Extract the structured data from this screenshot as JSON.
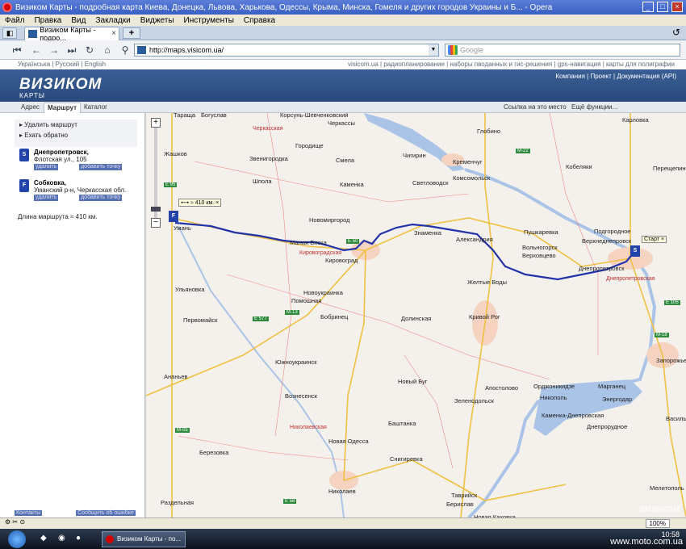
{
  "window": {
    "title": "Визиком Карты - подробная карта Киева, Донецка, Львова, Харькова, Одессы, Крыма, Минска, Гомеля и других городов Украины и Б... - Opera"
  },
  "menu": [
    "Файл",
    "Правка",
    "Вид",
    "Закладки",
    "Виджеты",
    "Инструменты",
    "Справка"
  ],
  "tab": {
    "label": "Визиком Карты - подро..."
  },
  "address": {
    "url": "http://maps.visicom.ua/",
    "search_placeholder": "Google"
  },
  "site": {
    "languages": "Українська  |  Русский  |  English",
    "top_right_links": "visicom.ua  |  радиопланирование  |  наборы пводанных и гис-решения  |  gps-навигация  |  карты для полиграфии",
    "logo": "ВИЗИКОМ",
    "logo_sub": "КАРТЫ",
    "header_links": "Компания  |  Проект  |  Документация (API)"
  },
  "panel_tabs": [
    "Адрес",
    "Маршрут",
    "Каталог"
  ],
  "map_links": {
    "link": "Ссылка на это место",
    "functions": "Ещё функции..."
  },
  "sidebar": {
    "actions": [
      "Удалить маршрут",
      "Ехать обратно"
    ],
    "start": {
      "marker": "S",
      "city": "Днепропетровск,",
      "address": "Флотская ул., 105",
      "btn1": "удалить",
      "btn2": "добавить точку"
    },
    "finish": {
      "marker": "F",
      "city": "Собковка,",
      "address": "Уманский р-н, Черкасская обл.",
      "btn1": "удалить",
      "btn2": "добавить точку"
    },
    "route_length": "Длина маршрута ≈ 410 км.",
    "bottom": {
      "contacts": "Контакты",
      "report": "Сообщить об ошибке"
    }
  },
  "map": {
    "bubble_length": "≈ 410 км.",
    "bubble_start": "Старт",
    "watermark": "ВИЗИКОМ",
    "cities": [
      {
        "n": "Черкассы"
      },
      {
        "n": "Глобино"
      },
      {
        "n": "Карловка"
      },
      {
        "n": "Городище"
      },
      {
        "n": "Звенигородка"
      },
      {
        "n": "Смела"
      },
      {
        "n": "Кременчуг"
      },
      {
        "n": "Кобеляки"
      },
      {
        "n": "Жашков"
      },
      {
        "n": "Шпола"
      },
      {
        "n": "Каменка"
      },
      {
        "n": "Светловодск"
      },
      {
        "n": "Новомиргород"
      },
      {
        "n": "Знаменка"
      },
      {
        "n": "Александрия"
      },
      {
        "n": "Пушкаревка"
      },
      {
        "n": "Подгородное"
      },
      {
        "n": "Верхнеднепровск"
      },
      {
        "n": "Вольногорск"
      },
      {
        "n": "Верховцево"
      },
      {
        "n": "Умань"
      },
      {
        "n": "Малая Виска"
      },
      {
        "n": "Кировоград"
      },
      {
        "n": "Днепропетровск"
      },
      {
        "n": "Желтые Воды"
      },
      {
        "n": "Ульяновка"
      },
      {
        "n": "Новоукраинка"
      },
      {
        "n": "Помошная"
      },
      {
        "n": "Первомайск"
      },
      {
        "n": "Бобринец"
      },
      {
        "n": "Долинская"
      },
      {
        "n": "Кривой Рог"
      },
      {
        "n": "Южноукраинск"
      },
      {
        "n": "Новый Буг"
      },
      {
        "n": "Апостолово"
      },
      {
        "n": "Зеленодольск"
      },
      {
        "n": "Вознесенск"
      },
      {
        "n": "Орджоникидзе"
      },
      {
        "n": "Марганец"
      },
      {
        "n": "Никополь"
      },
      {
        "n": "Энергодар"
      },
      {
        "n": "Каменка-Днепровская"
      },
      {
        "n": "Днепрорудное"
      },
      {
        "n": "Баштанка"
      },
      {
        "n": "Новая Одесса"
      },
      {
        "n": "Снигиревка"
      },
      {
        "n": "Березовка"
      },
      {
        "n": "Николаев"
      },
      {
        "n": "Раздельная"
      },
      {
        "n": "Запорожье"
      },
      {
        "n": "Мелитополь"
      },
      {
        "n": "Васильевка"
      },
      {
        "n": "Ананьев"
      },
      {
        "n": "Таврийск"
      },
      {
        "n": "Берислав"
      },
      {
        "n": "Новая Каховка"
      },
      {
        "n": "Перещепино"
      },
      {
        "n": "Корсунь-Шевченковский"
      },
      {
        "n": "Богуслав"
      },
      {
        "n": "Тараща"
      },
      {
        "n": "Комсомольск"
      },
      {
        "n": "Чигирин"
      }
    ],
    "regions": [
      {
        "n": "Черкасская"
      },
      {
        "n": "Кировоградская"
      },
      {
        "n": "Днепропетровская"
      },
      {
        "n": "Николаевская"
      }
    ],
    "roads": [
      {
        "n": "E 95"
      },
      {
        "n": "E 50"
      },
      {
        "n": "M-22"
      },
      {
        "n": "E 105"
      },
      {
        "n": "M-13"
      },
      {
        "n": "E 577"
      },
      {
        "n": "M-05"
      },
      {
        "n": "E 58"
      },
      {
        "n": "M-18"
      }
    ]
  },
  "status": {
    "zoom": "100%"
  },
  "taskbar": {
    "task": "Визиком Карты - по...",
    "watermark": "www.moto.com.ua",
    "clock": "10:58"
  }
}
